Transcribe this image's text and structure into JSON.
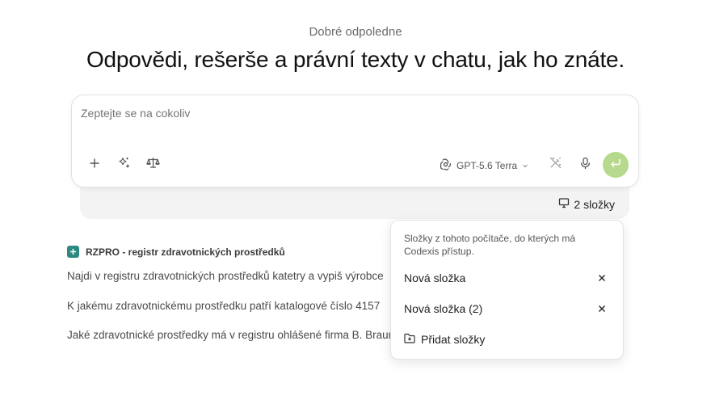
{
  "greeting": "Dobré odpoledne",
  "headline": "Odpovědi, rešerše a právní texty v chatu, jak ho znáte.",
  "composer": {
    "placeholder": "Zeptejte se na cokoliv",
    "model_label": "GPT-5.6 Terra",
    "icons": [
      "plus-icon",
      "sparkles-icon",
      "scales-icon",
      "openai-icon",
      "chevron-down-icon",
      "magic-wand-icon",
      "microphone-icon",
      "enter-icon"
    ]
  },
  "folders_toggle": {
    "label": "2 složky",
    "icon": "monitor-icon"
  },
  "source": {
    "label": "RZPRO - registr zdravotnických prostředků"
  },
  "suggestions": [
    "Najdi v registru zdravotnických prostředků katetry a vypiš výrobce",
    "K jakému zdravotnickému prostředku patří katalogové číslo 4157",
    "Jaké zdravotnické prostředky má v registru ohlášené firma B. Braun"
  ],
  "folders_popup": {
    "description": "Složky z tohoto počítače, do kterých má Codexis přístup.",
    "folders": [
      {
        "name": "Nová složka"
      },
      {
        "name": "Nová složka (2)"
      }
    ],
    "add_label": "Přidat složky"
  },
  "colors": {
    "send_button": "#b7d98d",
    "source_badge": "#2c8a80",
    "folders_bar": "#f3f3f3"
  }
}
